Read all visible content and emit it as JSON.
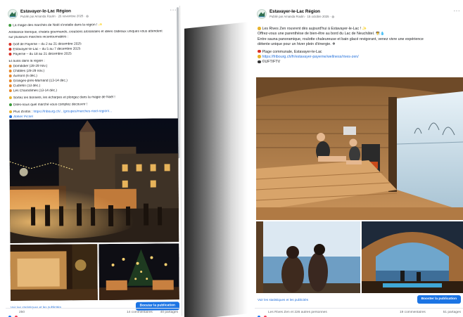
{
  "left_post": {
    "page_name": "Estavayer-le-Lac Région",
    "byline": "Publié par Amanda Roulin · 26 novembre 2025 · ",
    "more_label": "···",
    "lines": [
      {
        "text": "La magie des marchés de Noël s'installe dans la région ! ✨",
        "emoji_color": "#3a9b3a"
      },
      {
        "text": "",
        "gap": true
      },
      {
        "text": "Ambiance féerique, chalets gourmands, créations artisanales et idées cadeaux uniques vous attendent"
      },
      {
        "text": "sur plusieurs marchés incontournables :"
      },
      {
        "text": "",
        "gap": true
      },
      {
        "text": "Golf de Payerne – du 2 au 21 décembre 2025",
        "emoji_color": "#d93025"
      },
      {
        "text": "Estavayer-le-Lac – du 5 au 7 décembre 2025",
        "emoji_color": "#d93025"
      },
      {
        "text": "Payerne – du 18 au 21 décembre 2025",
        "emoji_color": "#d93025"
      },
      {
        "text": "",
        "gap": true
      },
      {
        "text": "Et aussi dans la région :"
      },
      {
        "text": "Domdidier (28-29 nov.)",
        "emoji_color": "#e8892c"
      },
      {
        "text": "Châbles (28-29 nov.)",
        "emoji_color": "#e8892c"
      },
      {
        "text": "Aumont (6 déc.)",
        "emoji_color": "#e8892c"
      },
      {
        "text": "Granges-près-Marnand (13-14 déc.)",
        "emoji_color": "#e8892c"
      },
      {
        "text": "Cudrefin (13 déc.)",
        "emoji_color": "#e8892c"
      },
      {
        "text": "Les Charodimes (13-14 déc.)",
        "emoji_color": "#e8892c"
      },
      {
        "text": "",
        "gap": true
      },
      {
        "text": "Sortez les bonnets, les écharpes et plongez dans la magie de Noël !",
        "emoji_color": "#e8b32c"
      },
      {
        "text": "",
        "gap": true
      },
      {
        "text": "Dites-nous quel marché vous comptez découvrir !",
        "emoji_color": "#3a9b3a"
      },
      {
        "text": "",
        "gap": true
      },
      {
        "text": "Plus d'infos : ",
        "link": "https://fribourg.ch/.../groupes/marches-noel-region/...",
        "emoji_color": "#e8b32c"
      },
      {
        "text": "",
        "link": "Atelier Picsel",
        "emoji_color": "#216fdb"
      }
    ],
    "stats_link": "Voir les statistiques et les publicités",
    "boost_label": "Booster la publication",
    "reaction_count": "250",
    "comments": "14 commentaires",
    "shares": "40 partages"
  },
  "right_post": {
    "page_name": "Estavayer-le-Lac Région",
    "byline": "Publié par Amanda Roulin · 15 octobre 2025 · ",
    "more_label": "···",
    "lines": [
      {
        "text": "Les Rives Zen rouvrent dès aujourd'hui à Estavayer-le-Lac ! ✨",
        "emoji_color": "#e8b32c"
      },
      {
        "text": "Offrez-vous une parenthèse de bien-être au bord du Lac de Neuchâtel. 🧖💧"
      },
      {
        "text": "Entre sauna panoramique, roulotte chaleureuse et bain glacé revigorant, venez vivre une expérience"
      },
      {
        "text": "détente unique pour un hiver plein d'énergie. ❄"
      },
      {
        "text": "",
        "gap": true
      },
      {
        "text": "Plage communale, Estavayer-le-Lac",
        "emoji_color": "#d93025"
      },
      {
        "text": "",
        "link": "https://fribourg.ch/fr/estavayer-payerne/wellness/rives-zen/",
        "emoji_color": "#e8b32c"
      },
      {
        "text": "©UFT/FTV",
        "emoji_color": "#333333"
      }
    ],
    "stats_link": "Voir les statistiques et les publicités",
    "boost_label": "Booster la publication",
    "reaction_count": "Les Rives Zen et 226 autres personnes",
    "comments": "19 commentaires",
    "shares": "51 partages"
  },
  "colors": {
    "accent": "#1b74e4",
    "link": "#216fdb",
    "like": "#1877f2",
    "love": "#f33e58"
  }
}
